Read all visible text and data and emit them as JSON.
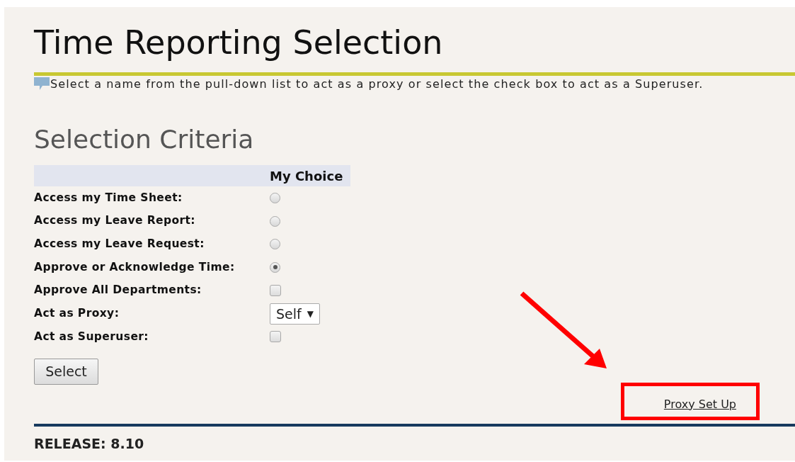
{
  "title": "Time Reporting Selection",
  "info": "Select a name from the pull-down list to act as a proxy or select the check box to act as a Superuser.",
  "section_title": "Selection Criteria",
  "table": {
    "header": "My Choice",
    "rows": [
      {
        "label": "Access my Time Sheet:",
        "kind": "radio",
        "selected": false
      },
      {
        "label": "Access my Leave Report:",
        "kind": "radio",
        "selected": false
      },
      {
        "label": "Access my Leave Request:",
        "kind": "radio",
        "selected": false
      },
      {
        "label": "Approve or Acknowledge Time:",
        "kind": "radio",
        "selected": true
      },
      {
        "label": "Approve All Departments:",
        "kind": "checkbox",
        "checked": false
      },
      {
        "label": "Act as Proxy:",
        "kind": "select",
        "value": "Self",
        "caret": "▼"
      },
      {
        "label": "Act as Superuser:",
        "kind": "checkbox",
        "checked": false
      }
    ]
  },
  "select_button": "Select",
  "proxy_link": {
    "label": "Proxy Set Up",
    "highlighted": true
  },
  "release": "RELEASE: 8.10"
}
